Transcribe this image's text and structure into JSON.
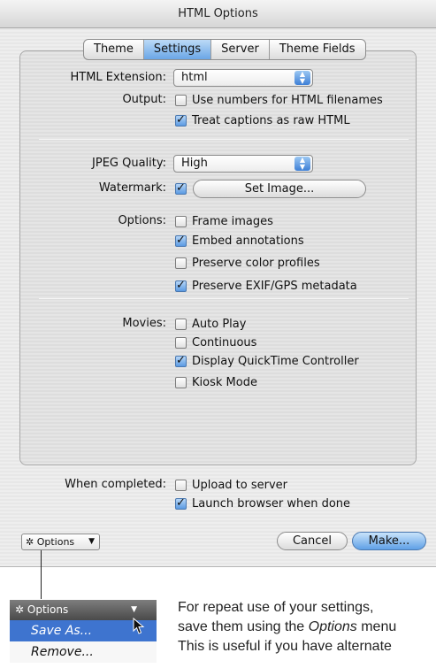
{
  "window": {
    "title": "HTML Options"
  },
  "tabs": [
    "Theme",
    "Settings",
    "Server",
    "Theme Fields"
  ],
  "active_tab": "Settings",
  "html_extension": {
    "label": "HTML Extension:",
    "value": "html"
  },
  "output": {
    "label": "Output:",
    "options": [
      {
        "label": "Use numbers for HTML filenames",
        "checked": false
      },
      {
        "label": "Treat captions as raw HTML",
        "checked": true
      }
    ]
  },
  "jpeg_quality": {
    "label": "JPEG Quality:",
    "value": "High"
  },
  "watermark": {
    "label": "Watermark:",
    "checked": true,
    "button": "Set Image..."
  },
  "options_group": {
    "label": "Options:",
    "options": [
      {
        "label": "Frame images",
        "checked": false
      },
      {
        "label": "Embed annotations",
        "checked": true
      },
      {
        "label": "Preserve color profiles",
        "checked": false
      },
      {
        "label": "Preserve EXIF/GPS metadata",
        "checked": true
      }
    ]
  },
  "movies": {
    "label": "Movies:",
    "options": [
      {
        "label": "Auto Play",
        "checked": false
      },
      {
        "label": "Continuous",
        "checked": false
      },
      {
        "label": "Display QuickTime Controller",
        "checked": true
      },
      {
        "label": "Kiosk Mode",
        "checked": false
      }
    ]
  },
  "when_completed": {
    "label": "When completed:",
    "options": [
      {
        "label": "Upload to server",
        "checked": false
      },
      {
        "label": "Launch browser when done",
        "checked": true
      }
    ]
  },
  "footer": {
    "options_label": "Options",
    "cancel": "Cancel",
    "make": "Make..."
  },
  "menu": {
    "header": "Options",
    "items": [
      "Save As...",
      "Remove..."
    ],
    "selected": "Save As..."
  },
  "caption": {
    "line1": "For repeat use of your settings,",
    "line2_pre": "save them using the ",
    "line2_em": "Options",
    "line2_post": " menu",
    "line3": "This is useful if you have alternate"
  }
}
